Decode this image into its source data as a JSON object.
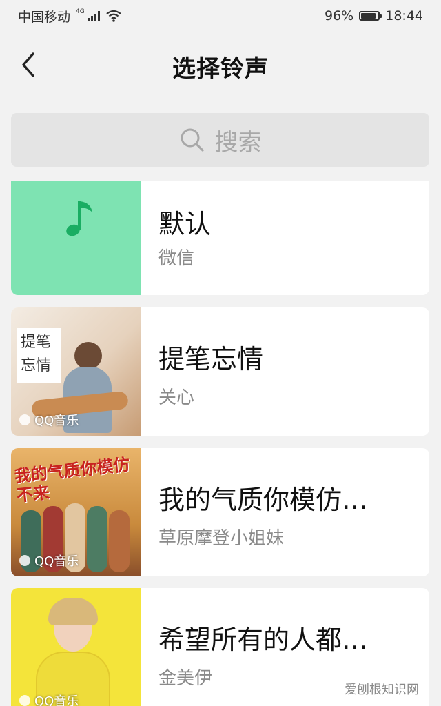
{
  "status_bar": {
    "carrier": "中国移动",
    "network": "4G",
    "battery": "96%",
    "battery_level": 0.96,
    "time": "18:44"
  },
  "nav": {
    "title": "选择铃声",
    "back_icon": "chevron-left-icon"
  },
  "search": {
    "placeholder": "搜索",
    "icon": "search-icon"
  },
  "ringtones": [
    {
      "title": "默认",
      "artist": "微信",
      "cover_color": "#7ee3b2",
      "icon": "music-note-icon"
    },
    {
      "title": "提笔忘情",
      "artist": "关心",
      "cover_text": "提笔忘情",
      "badge": "QQ音乐",
      "cover_color": "#e9d8c7"
    },
    {
      "title": "我的气质你模仿…",
      "artist": "草原摩登小姐妹",
      "cover_text": "我的气质你模仿不来",
      "badge": "QQ音乐",
      "cover_color": "#c98a3c"
    },
    {
      "title": "希望所有的人都…",
      "artist": "金美伊",
      "badge": "QQ音乐",
      "cover_color": "#f4e43a"
    }
  ],
  "watermark": "爱刨根知识网",
  "colors": {
    "background": "#f2f2f2",
    "card": "#ffffff",
    "default_cover": "#7ee3b2",
    "note_green": "#1aad63"
  }
}
